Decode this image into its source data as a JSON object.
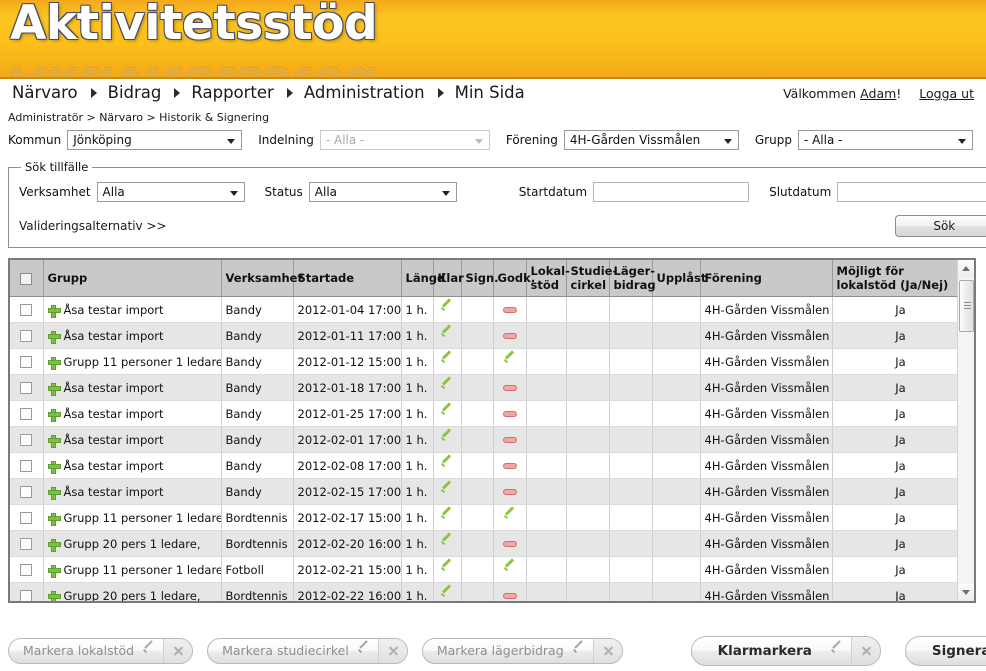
{
  "banner": {
    "logo_text": "Aktivitetsstöd"
  },
  "nav": {
    "items": [
      "Närvaro",
      "Bidrag",
      "Rapporter",
      "Administration",
      "Min Sida"
    ],
    "welcome_prefix": "Välkommen ",
    "user_name": "Adam",
    "welcome_suffix": "!",
    "logout_label": "Logga ut"
  },
  "breadcrumb": {
    "text": "Administratör > Närvaro > Historik & Signering"
  },
  "filters": {
    "kommun_label": "Kommun",
    "kommun_value": "Jönköping",
    "indelning_label": "Indelning",
    "indelning_value": "- Alla -",
    "forening_label": "Förening",
    "forening_value": "4H-Gården Vissmålen",
    "grupp_label": "Grupp",
    "grupp_value": "- Alla -"
  },
  "search_panel": {
    "legend": "Sök tillfälle",
    "verksamhet_label": "Verksamhet",
    "verksamhet_value": "Alla",
    "status_label": "Status",
    "status_value": "Alla",
    "startdatum_label": "Startdatum",
    "startdatum_value": "",
    "slutdatum_label": "Slutdatum",
    "slutdatum_value": "",
    "valideringsalternativ_label": "Valideringsalternativ >>",
    "sok_button": "Sök"
  },
  "table": {
    "headers": {
      "grupp": "Grupp",
      "verksamhet": "Verksamhet",
      "startade": "Startade",
      "langd": "Längd",
      "klar": "Klar",
      "sign": "Sign.",
      "godk": "Godk.",
      "lokalstod": "Lokal-stöd",
      "lokalstod_l1": "Lokal-",
      "lokalstod_l2": "stöd",
      "studiecirkel_l1": "Studie-",
      "studiecirkel_l2": "cirkel",
      "lagerbidrag_l1": "Läger-",
      "lagerbidrag_l2": "bidrag",
      "upplast": "Upplåst",
      "forening": "Förening",
      "mojligt_l1": "Möjligt för",
      "mojligt_l2": "lokalstöd (Ja/Nej)"
    },
    "rows": [
      {
        "grupp": "Åsa testar import",
        "verksamhet": "Bandy",
        "startade": "2012-01-04 17:00",
        "langd": "1 h.",
        "klar": "check",
        "sign": "",
        "godk": "minus",
        "lokalstod": "",
        "studiecirkel": "",
        "lagerbidrag": "",
        "upplast": "",
        "forening": "4H-Gården Vissmålen",
        "mojligt": "Ja"
      },
      {
        "grupp": "Åsa testar import",
        "verksamhet": "Bandy",
        "startade": "2012-01-11 17:00",
        "langd": "1 h.",
        "klar": "check",
        "sign": "",
        "godk": "minus",
        "lokalstod": "",
        "studiecirkel": "",
        "lagerbidrag": "",
        "upplast": "",
        "forening": "4H-Gården Vissmålen",
        "mojligt": "Ja"
      },
      {
        "grupp": "Grupp 11 personer 1 ledare",
        "verksamhet": "Bandy",
        "startade": "2012-01-12 15:00",
        "langd": "1 h.",
        "klar": "check",
        "sign": "",
        "godk": "check",
        "lokalstod": "",
        "studiecirkel": "",
        "lagerbidrag": "",
        "upplast": "",
        "forening": "4H-Gården Vissmålen",
        "mojligt": "Ja"
      },
      {
        "grupp": "Åsa testar import",
        "verksamhet": "Bandy",
        "startade": "2012-01-18 17:00",
        "langd": "1 h.",
        "klar": "check",
        "sign": "",
        "godk": "minus",
        "lokalstod": "",
        "studiecirkel": "",
        "lagerbidrag": "",
        "upplast": "",
        "forening": "4H-Gården Vissmålen",
        "mojligt": "Ja"
      },
      {
        "grupp": "Åsa testar import",
        "verksamhet": "Bandy",
        "startade": "2012-01-25 17:00",
        "langd": "1 h.",
        "klar": "check",
        "sign": "",
        "godk": "minus",
        "lokalstod": "",
        "studiecirkel": "",
        "lagerbidrag": "",
        "upplast": "",
        "forening": "4H-Gården Vissmålen",
        "mojligt": "Ja"
      },
      {
        "grupp": "Åsa testar import",
        "verksamhet": "Bandy",
        "startade": "2012-02-01 17:00",
        "langd": "1 h.",
        "klar": "check",
        "sign": "",
        "godk": "minus",
        "lokalstod": "",
        "studiecirkel": "",
        "lagerbidrag": "",
        "upplast": "",
        "forening": "4H-Gården Vissmålen",
        "mojligt": "Ja"
      },
      {
        "grupp": "Åsa testar import",
        "verksamhet": "Bandy",
        "startade": "2012-02-08 17:00",
        "langd": "1 h.",
        "klar": "check",
        "sign": "",
        "godk": "minus",
        "lokalstod": "",
        "studiecirkel": "",
        "lagerbidrag": "",
        "upplast": "",
        "forening": "4H-Gården Vissmålen",
        "mojligt": "Ja"
      },
      {
        "grupp": "Åsa testar import",
        "verksamhet": "Bandy",
        "startade": "2012-02-15 17:00",
        "langd": "1 h.",
        "klar": "check",
        "sign": "",
        "godk": "minus",
        "lokalstod": "",
        "studiecirkel": "",
        "lagerbidrag": "",
        "upplast": "",
        "forening": "4H-Gården Vissmålen",
        "mojligt": "Ja"
      },
      {
        "grupp": "Grupp 11 personer 1 ledare",
        "verksamhet": "Bordtennis",
        "startade": "2012-02-17 15:00",
        "langd": "1 h.",
        "klar": "check",
        "sign": "",
        "godk": "check",
        "lokalstod": "",
        "studiecirkel": "",
        "lagerbidrag": "",
        "upplast": "",
        "forening": "4H-Gården Vissmålen",
        "mojligt": "Ja"
      },
      {
        "grupp": "Grupp 20 pers 1 ledare,",
        "verksamhet": "Bordtennis",
        "startade": "2012-02-20 16:00",
        "langd": "1 h.",
        "klar": "check",
        "sign": "",
        "godk": "minus",
        "lokalstod": "",
        "studiecirkel": "",
        "lagerbidrag": "",
        "upplast": "",
        "forening": "4H-Gården Vissmålen",
        "mojligt": "Ja"
      },
      {
        "grupp": "Grupp 11 personer 1 ledare",
        "verksamhet": "Fotboll",
        "startade": "2012-02-21 15:00",
        "langd": "1 h.",
        "klar": "check",
        "sign": "",
        "godk": "check",
        "lokalstod": "",
        "studiecirkel": "",
        "lagerbidrag": "",
        "upplast": "",
        "forening": "4H-Gården Vissmålen",
        "mojligt": "Ja"
      },
      {
        "grupp": "Grupp 20 pers 1 ledare,",
        "verksamhet": "Bordtennis",
        "startade": "2012-02-22 16:00",
        "langd": "1 h.",
        "klar": "check",
        "sign": "",
        "godk": "minus",
        "lokalstod": "",
        "studiecirkel": "",
        "lagerbidrag": "",
        "upplast": "",
        "forening": "4H-Gården Vissmålen",
        "mojligt": "Ja"
      }
    ]
  },
  "footer_buttons": [
    {
      "label": "Markera lokalstöd",
      "size": "small"
    },
    {
      "label": "Markera studiecirkel",
      "size": "small"
    },
    {
      "label": "Markera lägerbidrag",
      "size": "small"
    },
    {
      "label": "Klarmarkera",
      "size": "big"
    },
    {
      "label": "Signera",
      "size": "big"
    }
  ],
  "colors": {
    "banner_accent": "#fcc01b",
    "banner_border": "#c98b12",
    "header_row": "#c9c9c9",
    "row_alt": "#e6e6e6",
    "check_green": "#8cc63e",
    "plus_green": "#7ac143",
    "minus_red": "#f0a7a7"
  }
}
